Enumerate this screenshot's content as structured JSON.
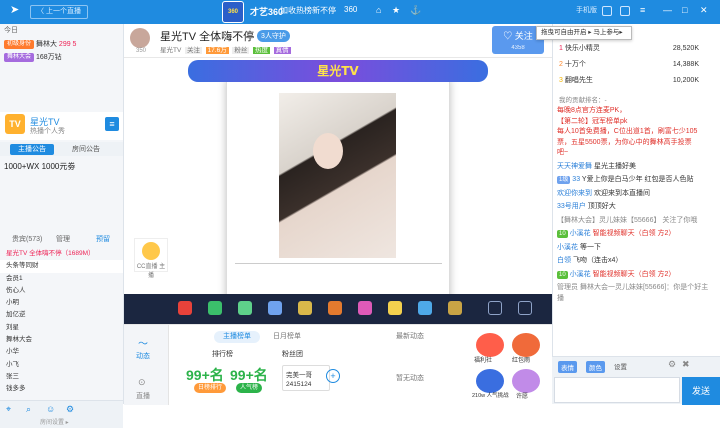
{
  "topbar": {
    "back": "〈 上一个直播",
    "brand": "才艺360",
    "nav": "加收热榜新不停",
    "vip": "360",
    "icons": [
      "home-icon",
      "star-icon",
      "anchor-icon"
    ],
    "actions": [
      "手机版",
      "皮肤",
      "菜单"
    ],
    "window_controls": [
      "—",
      "□",
      "✕"
    ]
  },
  "left": {
    "header": {
      "title": "今日"
    },
    "top_rows": [
      {
        "badge": "初级身份",
        "name": "舞林大",
        "value": "299 5"
      },
      {
        "badge": "舞林大会",
        "name": "168万钻"
      }
    ],
    "channel": {
      "avatar": "TV",
      "name": "星光TV",
      "sub": "热播个人秀"
    },
    "tabs": [
      "主播公告",
      "房间公告"
    ],
    "announcement": "1000+WX  1000元劵",
    "user_tabs": [
      "贵宾(573)",
      "管理",
      "预留"
    ],
    "users": [
      "星光TV 全体嗨不停（1689M）",
      "头条等同财",
      "会员1",
      "伤心人",
      "小明",
      "加亿逆",
      "刘星",
      "舞林大会",
      "小华",
      "小飞",
      "张三",
      "钱多多",
      "小鹿"
    ],
    "footer": "房间设置 ▸"
  },
  "center": {
    "title": "星光TV 全体嗨不停",
    "guard": "3人守护",
    "viewers": "350",
    "meta": [
      "星光TV",
      "关注",
      "17.6万",
      "粉丝",
      "热度",
      "真情"
    ],
    "follow": {
      "label": "♡ 关注",
      "count": "4358"
    },
    "banner": "星光TV",
    "side_badge": "CC直播 主播",
    "gift_icons": [
      "red-envelope-icon",
      "flower-icon",
      "clover-icon",
      "brush-icon",
      "rocket-icon",
      "firework-icon",
      "balloon-icon",
      "sparkle-icon",
      "gift-box-icon",
      "treasure-icon",
      "scroll-icon",
      "box-icon"
    ],
    "bottom": {
      "tabs": [
        "主播榜单",
        "日月榜单"
      ],
      "rail": [
        "动态",
        "直播"
      ],
      "rank_label": "排行榜",
      "fans_label": "粉丝团",
      "latest_label": "最新动态",
      "left_stat": {
        "value": "99+名",
        "label": "日榜排行"
      },
      "mid_stat": {
        "value": "99+名",
        "label": "人气榜"
      },
      "fans": {
        "name": "完美一哥",
        "num": "2415124"
      },
      "no_dynamic": "暂无动态",
      "acts": [
        "福利社",
        "红包雨",
        "210w 人气挑战",
        "许愿"
      ]
    }
  },
  "right": {
    "tooltip": "拖曳可自由开启 ▸ 马上参与▸",
    "ranks": [
      {
        "n": "1",
        "name": "快乐小精灵",
        "amt": "28,520K"
      },
      {
        "n": "2",
        "name": "十万个",
        "amt": "14,388K"
      },
      {
        "n": "3",
        "name": "翻唱先生",
        "amt": "10,200K"
      }
    ],
    "manager": "我的贡献排名：-",
    "notice_lines": [
      "每晚8点官方连麦PK，",
      "【第二轮】冠军榜单pk",
      "每人10首免费播，C位出道1首，刷富七少105",
      "票，五星5500票，为你心中的舞林高手投票",
      "吧~"
    ],
    "messages": [
      {
        "user": "天天神爱舞",
        "text": "星光主播好美"
      },
      {
        "user": "33",
        "text": "Y爱上你是白马少年",
        "extra": "红包是否人色贴"
      },
      {
        "user": "欢迎你来到",
        "text": "欢迎来到本直播间"
      },
      {
        "user": "33号用户",
        "text": "顶顶好大"
      },
      {
        "user": "【舞林大会】灵儿妹妹【55666】",
        "text": "关注了你哦"
      },
      {
        "user": "小溪花",
        "text": "智能视频聊天（白领 方2）"
      },
      {
        "user": "小溪花",
        "text": "等一下"
      },
      {
        "user": "白领",
        "text": "飞吻（连击x4）"
      },
      {
        "user": "小溪花",
        "text": "智能视频聊天（白领 方2）"
      },
      {
        "user": "管理员",
        "text": "舞林大会一灵儿妹妹[55666]：你是个好主播"
      }
    ],
    "tools": [
      "表情",
      "颜色",
      "设置"
    ],
    "send": "发送"
  }
}
